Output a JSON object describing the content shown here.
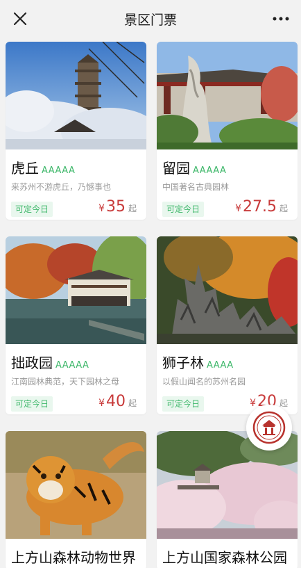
{
  "header": {
    "title": "景区门票",
    "close_icon": "close-icon",
    "more_icon": "more-icon"
  },
  "colors": {
    "grade": "#3fb86b",
    "price": "#c83a3a",
    "tag_bg": "#e9f7ee",
    "background": "#f2f2f2"
  },
  "cards": [
    {
      "name": "虎丘",
      "grade": "AAAAA",
      "desc": "来苏州不游虎丘，乃憾事也",
      "tag": "可定今日",
      "currency": "¥",
      "price": "35",
      "suffix": "起"
    },
    {
      "name": "留园",
      "grade": "AAAAA",
      "desc": "中国著名古典园林",
      "tag": "可定今日",
      "currency": "¥",
      "price": "27.5",
      "suffix": "起"
    },
    {
      "name": "拙政园",
      "grade": "AAAAA",
      "desc": "江南园林典范，天下园林之母",
      "tag": "可定今日",
      "currency": "¥",
      "price": "40",
      "suffix": "起"
    },
    {
      "name": "狮子林",
      "grade": "AAAA",
      "desc": "以假山闻名的苏州名园",
      "tag": "可定今日",
      "currency": "¥",
      "price": "20",
      "suffix": "起"
    },
    {
      "name": "上方山森林动物世界",
      "grade": "",
      "desc": "",
      "tag": "",
      "currency": "",
      "price": "",
      "suffix": ""
    },
    {
      "name": "上方山国家森林公园",
      "grade": "",
      "desc": "",
      "tag": "",
      "currency": "",
      "price": "",
      "suffix": ""
    }
  ]
}
